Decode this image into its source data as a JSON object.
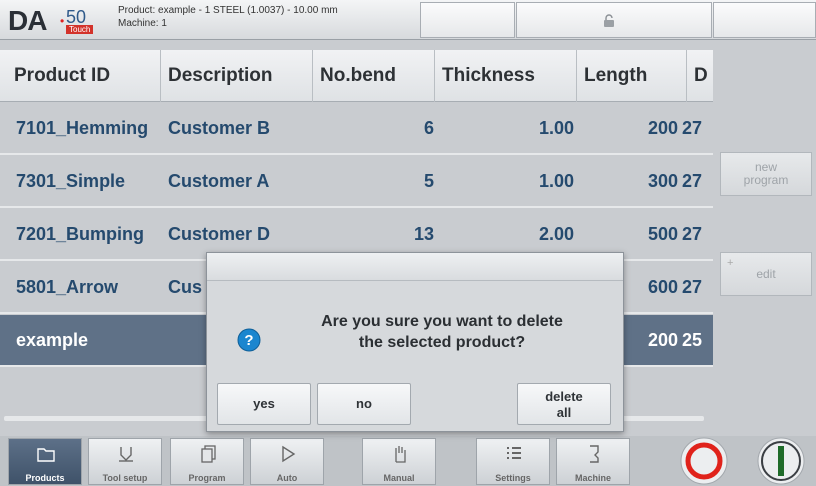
{
  "header": {
    "logo_brand": "DA",
    "logo_number": "50",
    "logo_badge": "Touch",
    "product_line": "Product: example - 1 STEEL (1.0037) - 10.00 mm",
    "machine_line": "Machine: 1"
  },
  "table": {
    "columns": [
      "Product ID",
      "Description",
      "No.bend",
      "Thickness",
      "Length",
      "D"
    ],
    "rows": [
      {
        "id": "7101_Hemming",
        "description": "Customer B",
        "bends": "6",
        "thickness": "1.00",
        "length": "200",
        "extra": "27"
      },
      {
        "id": "7301_Simple",
        "description": "Customer A",
        "bends": "5",
        "thickness": "1.00",
        "length": "300",
        "extra": "27"
      },
      {
        "id": "7201_Bumping",
        "description": "Customer D",
        "bends": "13",
        "thickness": "2.00",
        "length": "500",
        "extra": "27"
      },
      {
        "id": "5801_Arrow",
        "description": "Cus",
        "bends": "",
        "thickness": "",
        "length": "600",
        "extra": "27"
      },
      {
        "id": "example",
        "description": "",
        "bends": "",
        "thickness": "",
        "length": "200",
        "extra": "25"
      }
    ]
  },
  "side_buttons": {
    "new_program": "new program",
    "edit": "edit",
    "edit_plus": "+"
  },
  "dialog": {
    "message_line1": "Are you sure you want to delete",
    "message_line2": "the selected product?",
    "yes": "yes",
    "no": "no",
    "delete_all_line1": "delete",
    "delete_all_line2": "all"
  },
  "toolbar": {
    "tabs": [
      {
        "label": "Products",
        "icon": "folder-icon"
      },
      {
        "label": "Tool setup",
        "icon": "tool-setup-icon"
      },
      {
        "label": "Program",
        "icon": "program-pages-icon"
      },
      {
        "label": "Auto",
        "icon": "play-icon"
      },
      {
        "label": "Manual",
        "icon": "hand-icon"
      },
      {
        "label": "Settings",
        "icon": "settings-list-icon"
      },
      {
        "label": "Machine",
        "icon": "machine-icon"
      }
    ],
    "active_tab": "Products"
  },
  "colors": {
    "selected_row": "#5f7187",
    "text_link": "#254a6e",
    "stop_red": "#e0221b",
    "start_green": "#1f6b2a"
  }
}
